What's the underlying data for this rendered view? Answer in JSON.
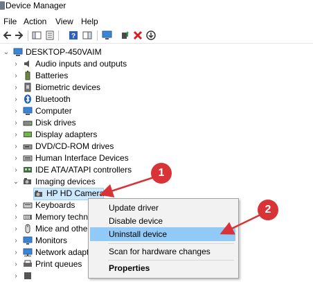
{
  "window": {
    "title": "Device Manager"
  },
  "menu": [
    "File",
    "Action",
    "View",
    "Help"
  ],
  "toolbar": [
    {
      "name": "back-icon",
      "interactable": true
    },
    {
      "name": "forward-icon",
      "interactable": true
    },
    {
      "name": "show-hide-console-tree-icon",
      "interactable": true
    },
    {
      "name": "properties-icon",
      "interactable": true
    },
    {
      "name": "help-icon",
      "interactable": true
    },
    {
      "name": "action-pane-icon",
      "interactable": true
    },
    {
      "name": "monitor-icon",
      "interactable": true
    },
    {
      "name": "update-driver-icon",
      "interactable": true
    },
    {
      "name": "uninstall-icon",
      "interactable": true
    },
    {
      "name": "scan-download-icon",
      "interactable": true
    }
  ],
  "tree": {
    "root": "DESKTOP-450VAIM",
    "items": [
      {
        "label": "Audio inputs and outputs",
        "icon": "speaker-icon",
        "expanded": false
      },
      {
        "label": "Batteries",
        "icon": "battery-icon",
        "expanded": false
      },
      {
        "label": "Biometric devices",
        "icon": "biometric-icon",
        "expanded": false
      },
      {
        "label": "Bluetooth",
        "icon": "bluetooth-icon",
        "expanded": false
      },
      {
        "label": "Computer",
        "icon": "computer-icon",
        "expanded": false
      },
      {
        "label": "Disk drives",
        "icon": "disk-drive-icon",
        "expanded": false
      },
      {
        "label": "Display adapters",
        "icon": "display-adapter-icon",
        "expanded": false
      },
      {
        "label": "DVD/CD-ROM drives",
        "icon": "dvd-drive-icon",
        "expanded": false
      },
      {
        "label": "Human Interface Devices",
        "icon": "hid-icon",
        "expanded": false
      },
      {
        "label": "IDE ATA/ATAPI controllers",
        "icon": "ide-controller-icon",
        "expanded": false
      },
      {
        "label": "Imaging devices",
        "icon": "camera-icon",
        "expanded": true
      },
      {
        "label": "HP HD Camera",
        "icon": "camera-icon",
        "child": true,
        "selected": true
      },
      {
        "label": "Keyboards",
        "icon": "keyboard-icon",
        "expanded": false
      },
      {
        "label": "Memory techno",
        "icon": "memory-icon",
        "expanded": false
      },
      {
        "label": "Mice and other",
        "icon": "mouse-icon",
        "expanded": false
      },
      {
        "label": "Monitors",
        "icon": "monitor-icon",
        "expanded": false
      },
      {
        "label": "Network adapt",
        "icon": "network-adapter-icon",
        "expanded": false
      },
      {
        "label": "Print queues",
        "icon": "printer-icon",
        "expanded": false
      },
      {
        "label": "",
        "icon": "processor-icon",
        "expanded": false
      }
    ]
  },
  "context_menu": {
    "items": [
      {
        "label": "Update driver"
      },
      {
        "label": "Disable device"
      },
      {
        "label": "Uninstall device",
        "highlighted": true
      },
      {
        "separator": true
      },
      {
        "label": "Scan for hardware changes"
      },
      {
        "separator": true
      },
      {
        "label": "Properties",
        "bold": true
      }
    ]
  },
  "annotations": [
    {
      "number": "1"
    },
    {
      "number": "2"
    }
  ],
  "colors": {
    "highlight": "#91c9f7",
    "annotation": "#d83336",
    "selected_row": "#cce8ff"
  }
}
